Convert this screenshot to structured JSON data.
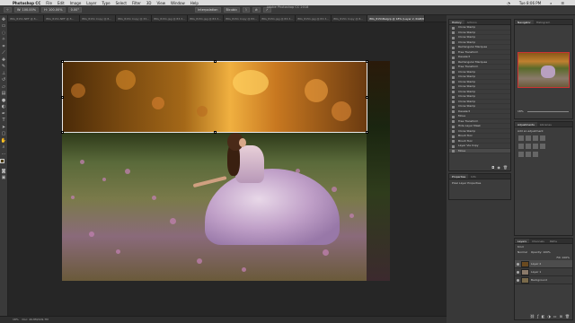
{
  "menubar": {
    "app": "Photoshop CC",
    "items": [
      "File",
      "Edit",
      "Image",
      "Layer",
      "Type",
      "Select",
      "Filter",
      "3D",
      "View",
      "Window",
      "Help"
    ],
    "clock": "Tue 8:06 PM"
  },
  "window_title": "Adobe Photoshop CC 2018",
  "optionbar": {
    "fields": [
      "W: 100.00%",
      "H: 100.00%",
      "0.00°",
      "Interpolation",
      "Bicubic",
      "W: 0"
    ]
  },
  "tabs": [
    "IMG_8151.NEF @ 8...",
    "IMG_8151.NEF @ 8...",
    "IMG_8151 Copy @ 8...",
    "IMG_8151 Copy @ 33...",
    "IMG_8151.jpg @ 83.3...",
    "IMG_8151.jpg @ 83.3...",
    "IMG_8151 Copy @ 83...",
    "IMG_8151.jpg @ 83.3...",
    "IMG_8151.jpg @ 83.3...",
    "IMG_8151 Copy @ 8...",
    "IMG_8151.jpg @ 83...",
    "IMG_8151.jpg @ 83.3...",
    "IMG_8151Belgrp @ 18% (Layer 2, RGB/8)"
  ],
  "history": {
    "tabs": [
      "History",
      "Actions"
    ],
    "items": [
      "Clone Stamp",
      "Clone Stamp",
      "Clone Stamp",
      "Clone Stamp",
      "Rectangular Marquee",
      "Free Transform",
      "Deselect",
      "Rectangular Marquee",
      "Free Transform",
      "Clone Stamp",
      "Clone Stamp",
      "Clone Stamp",
      "Clone Stamp",
      "Clone Stamp",
      "Clone Stamp",
      "Clone Stamp",
      "Clone Stamp",
      "Deselect",
      "Move",
      "Free Transform",
      "Hide Layer Mask",
      "Clone Stamp",
      "Brush Tool",
      "Brush Tool",
      "Layer Via Copy",
      "Layer Visibility",
      "Clone Stamp",
      "Move"
    ]
  },
  "navigator": {
    "tabs": [
      "Navigator",
      "Histogram"
    ],
    "zoom": "18%"
  },
  "adjustments": {
    "tabs": [
      "Adjustments",
      "Libraries"
    ],
    "label": "Add an adjustment"
  },
  "properties": {
    "tabs": [
      "Properties",
      "Info"
    ],
    "label": "Pixel Layer Properties"
  },
  "layers": {
    "tabs": [
      "Layers",
      "Channels",
      "Paths"
    ],
    "blend": "Normal",
    "opacity": "Opacity: 100%",
    "fill": "Fill: 100%",
    "kind": "Kind",
    "rows": [
      "Layer 2",
      "Layer 1",
      "Background"
    ]
  },
  "status": {
    "zoom": "18%",
    "doc": "Doc: 49.8M/109.7M"
  },
  "tools": [
    "move-icon",
    "marquee-icon",
    "lasso-icon",
    "magic-wand-icon",
    "crop-icon",
    "eyedropper-icon",
    "healing-icon",
    "brush-icon",
    "clone-stamp-icon",
    "history-brush-icon",
    "eraser-icon",
    "gradient-icon",
    "blur-icon",
    "dodge-icon",
    "pen-icon",
    "type-icon",
    "path-select-icon",
    "shape-icon",
    "hand-icon",
    "zoom-icon"
  ]
}
